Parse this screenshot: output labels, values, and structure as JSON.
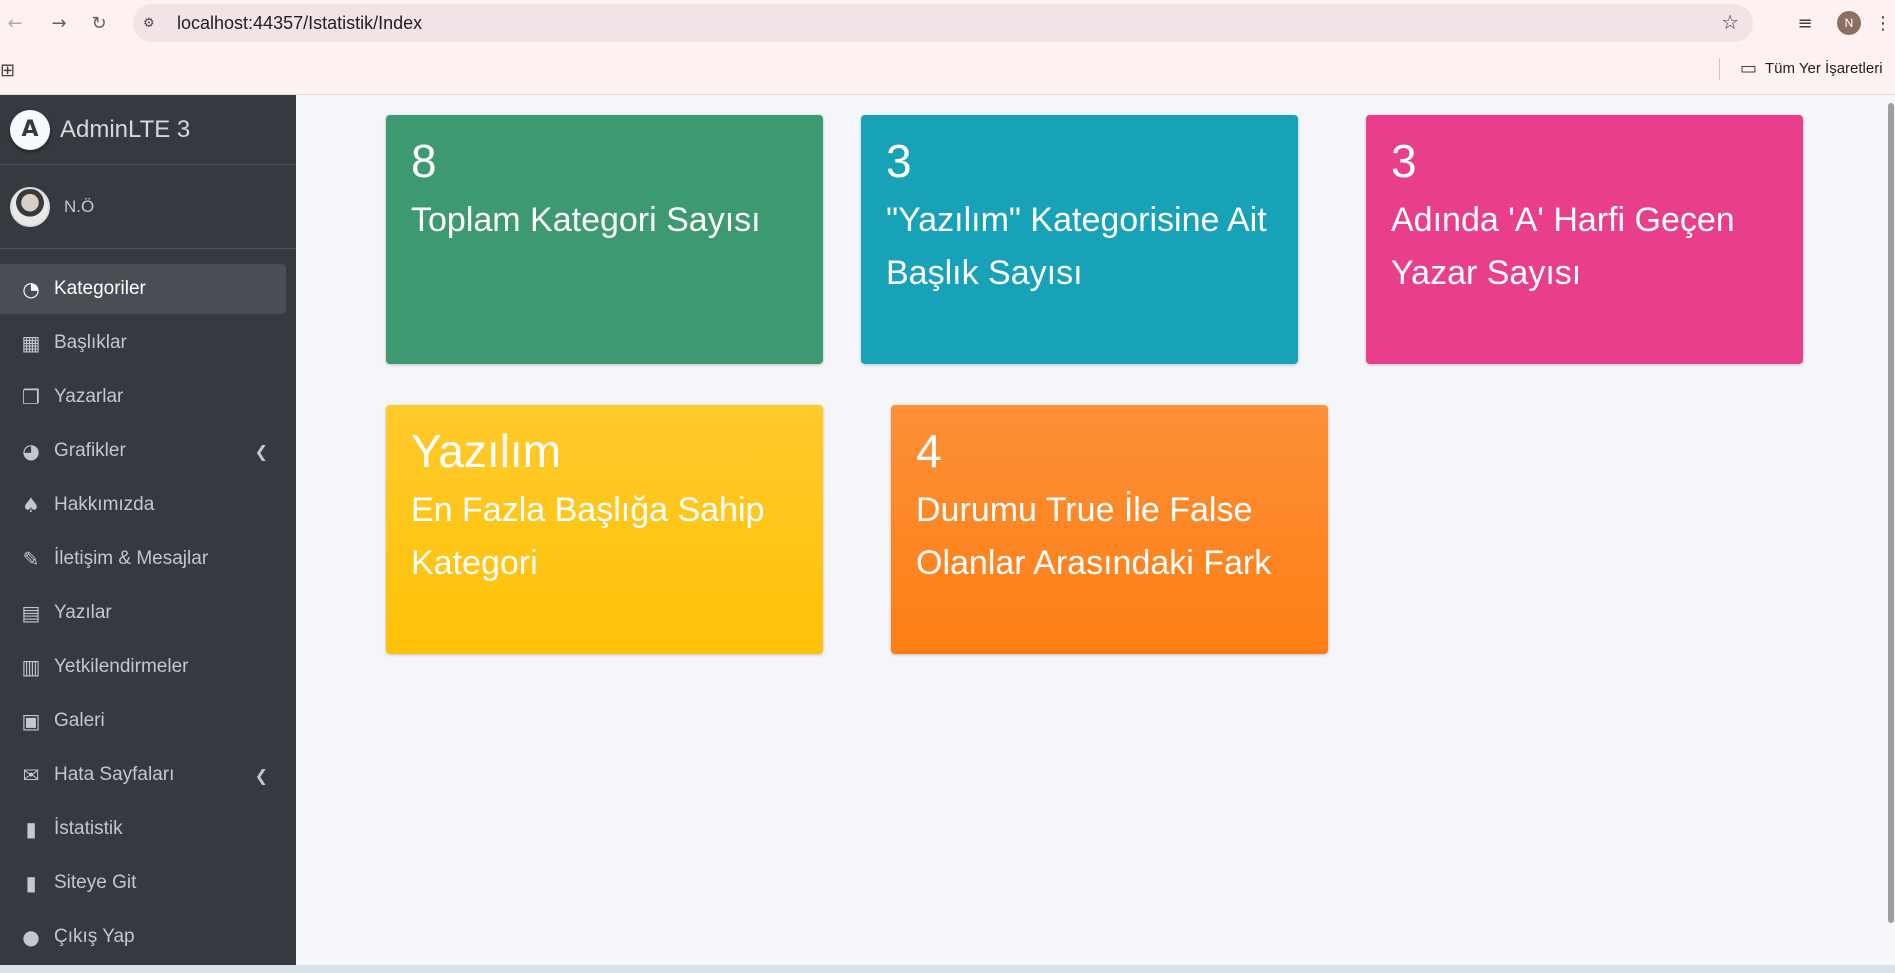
{
  "browser": {
    "url": "localhost:44357/Istatistik/Index",
    "back_icon": "←",
    "forward_icon": "→",
    "reload_icon": "↻",
    "profile_initial": "N",
    "bookmarks_folder": "Tüm Yer İşaretleri"
  },
  "sidebar": {
    "brand": "AdminLTE 3",
    "logo_letter": "A",
    "user_name": "N.Ö",
    "items": [
      {
        "label": "Kategoriler",
        "icon": "tachometer-icon"
      },
      {
        "label": "Başlıklar",
        "icon": "grid-icon"
      },
      {
        "label": "Yazarlar",
        "icon": "copy-icon"
      },
      {
        "label": "Grafikler",
        "icon": "pie-chart-icon"
      },
      {
        "label": "Hakkımızda",
        "icon": "tree-icon"
      },
      {
        "label": "İletişim & Mesajlar",
        "icon": "edit-icon"
      },
      {
        "label": "Yazılar",
        "icon": "table-icon"
      },
      {
        "label": "Yetkilendirmeler",
        "icon": "calendar-icon"
      },
      {
        "label": "Galeri",
        "icon": "image-icon"
      },
      {
        "label": "Hata Sayfaları",
        "icon": "envelope-icon"
      },
      {
        "label": "İstatistik",
        "icon": "book-icon"
      },
      {
        "label": "Siteye Git",
        "icon": "book-icon"
      },
      {
        "label": "Çıkış Yap",
        "icon": "apple-icon"
      }
    ]
  },
  "stats": [
    {
      "value": "8",
      "label": "Toplam Kategori Sayısı",
      "color": "#3d9970"
    },
    {
      "value": "3",
      "label": "\"Yazılım\" Kategorisine Ait Başlık Sayısı",
      "color": "#17a2b8"
    },
    {
      "value": "3",
      "label": "Adında 'A' Harfi Geçen Yazar Sayısı",
      "color": "#e83e8c"
    },
    {
      "value": "Yazılım",
      "label": "En Fazla Başlığa Sahip Kategori",
      "color": "#ffc107"
    },
    {
      "value": "4",
      "label": "Durumu True İle False Olanlar Arasındaki Fark",
      "color": "#fd7e14"
    }
  ]
}
